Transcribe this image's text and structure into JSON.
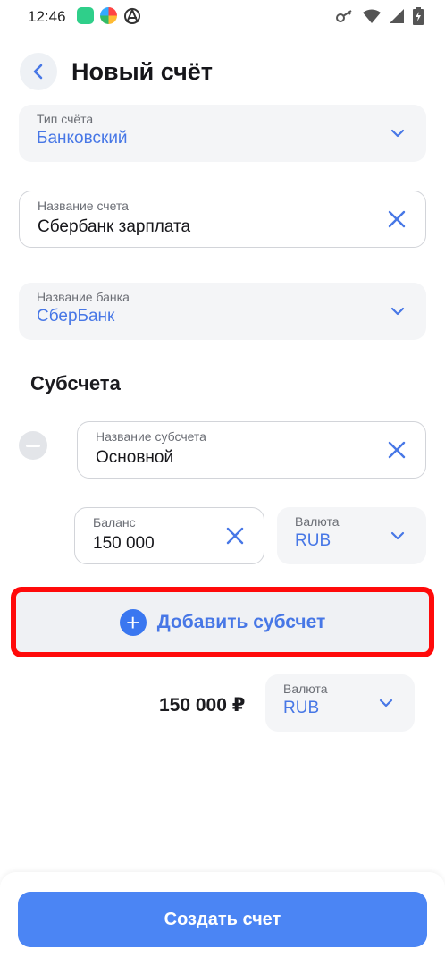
{
  "status_bar": {
    "time": "12:46",
    "left_icons": [
      "chat-app-icon",
      "browser-app-icon",
      "anarchy-icon"
    ],
    "right_icons": [
      "key-icon",
      "wifi-icon",
      "signal-icon",
      "battery-icon"
    ]
  },
  "header": {
    "title": "Новый счёт",
    "back_icon": "chevron-left-icon"
  },
  "account_type": {
    "label": "Тип счёта",
    "value": "Банковский"
  },
  "account_name": {
    "label": "Название счета",
    "value": "Сбербанк зарплата"
  },
  "bank_name": {
    "label": "Название банка",
    "value": "СберБанк"
  },
  "subaccounts": {
    "title": "Субсчета",
    "items": [
      {
        "name_label": "Название субсчета",
        "name_value": "Основной",
        "balance_label": "Баланс",
        "balance_value": "150 000",
        "currency_label": "Валюта",
        "currency_value": "RUB"
      }
    ],
    "add_label": "Добавить субсчет"
  },
  "summary": {
    "total": "150 000 ₽",
    "currency_label": "Валюта",
    "currency_value": "RUB"
  },
  "create_button": "Создать счет",
  "colors": {
    "accent": "#4b85f4",
    "link": "#4777e6",
    "field_bg": "#f4f5f7",
    "highlight": "#ff0a0a"
  }
}
